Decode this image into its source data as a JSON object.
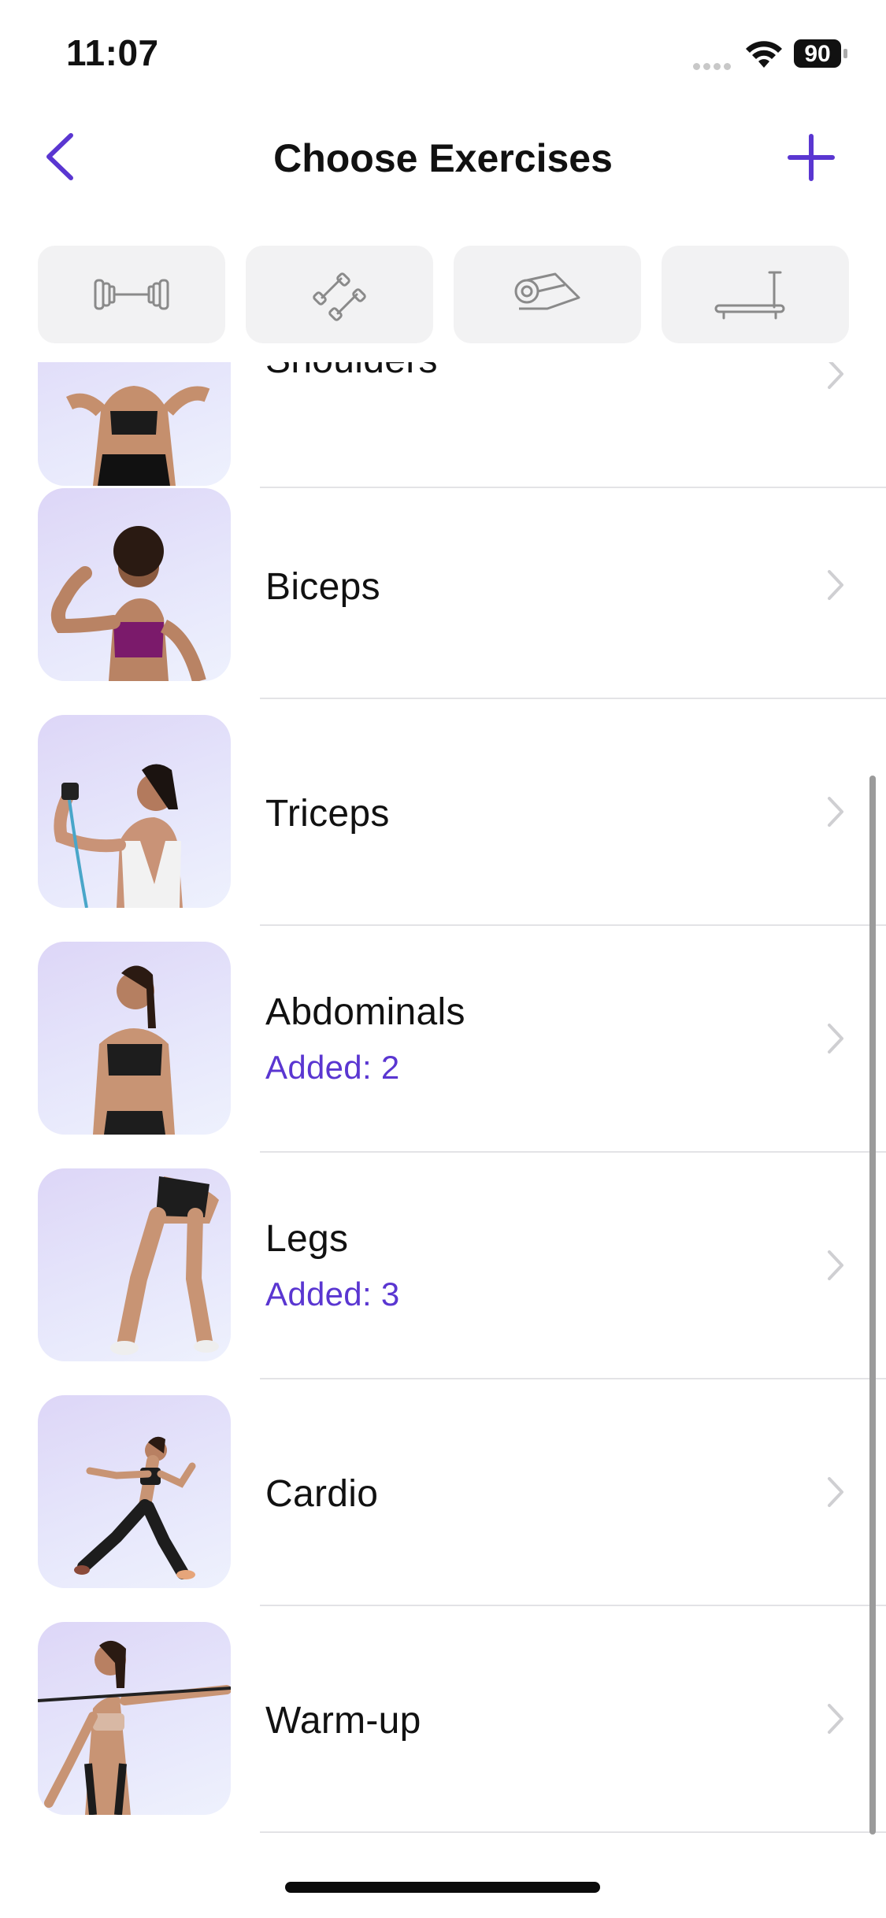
{
  "status_bar": {
    "time": "11:07",
    "battery": "90"
  },
  "nav": {
    "title": "Choose Exercises",
    "back_icon": "chevron-left-icon",
    "add_icon": "plus-icon",
    "accent": "#5a36d1"
  },
  "filters": [
    {
      "icon": "barbell-icon"
    },
    {
      "icon": "dumbbells-icon"
    },
    {
      "icon": "yoga-mat-icon"
    },
    {
      "icon": "treadmill-icon"
    }
  ],
  "categories": [
    {
      "title": "Shoulders",
      "subtitle": ""
    },
    {
      "title": "Biceps",
      "subtitle": ""
    },
    {
      "title": "Triceps",
      "subtitle": ""
    },
    {
      "title": "Abdominals",
      "subtitle": "Added: 2"
    },
    {
      "title": "Legs",
      "subtitle": "Added: 3"
    },
    {
      "title": "Cardio",
      "subtitle": ""
    },
    {
      "title": "Warm-up",
      "subtitle": ""
    }
  ]
}
